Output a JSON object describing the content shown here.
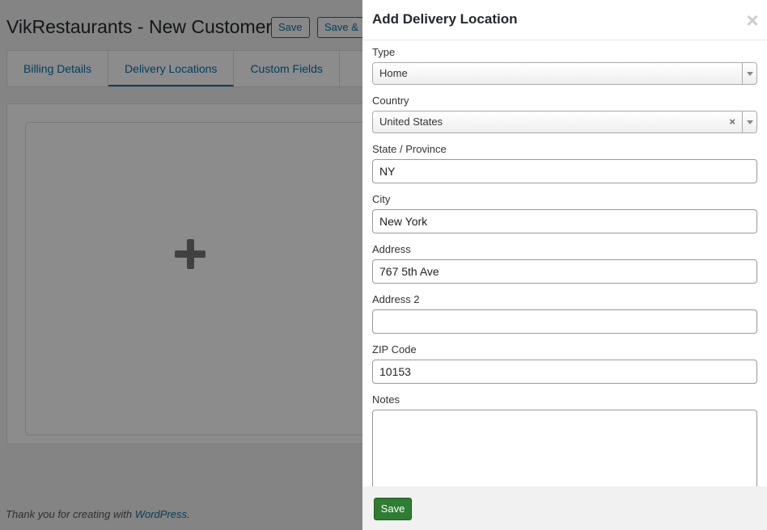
{
  "page": {
    "title": "VikRestaurants - New Customer",
    "buttons": [
      "Save",
      "Save &"
    ],
    "footer_text": "Thank you for creating with ",
    "footer_link": "WordPress",
    "footer_suffix": "."
  },
  "tabs": [
    {
      "label": "Billing Details"
    },
    {
      "label": "Delivery Locations",
      "active": true
    },
    {
      "label": "Custom Fields"
    }
  ],
  "add_icon": "plus-icon",
  "modal": {
    "title": "Add Delivery Location",
    "close_icon": "close-icon",
    "fields": {
      "type": {
        "label": "Type",
        "value": "Home"
      },
      "country": {
        "label": "Country",
        "value": "United States"
      },
      "state": {
        "label": "State / Province",
        "value": "NY"
      },
      "city": {
        "label": "City",
        "value": "New York"
      },
      "address": {
        "label": "Address",
        "value": "767 5th Ave"
      },
      "address2": {
        "label": "Address 2",
        "value": ""
      },
      "zip": {
        "label": "ZIP Code",
        "value": "10153"
      },
      "notes": {
        "label": "Notes",
        "value": ""
      }
    },
    "save_label": "Save"
  },
  "colors": {
    "accent": "#0073aa",
    "save_button": "#2e7d32"
  }
}
